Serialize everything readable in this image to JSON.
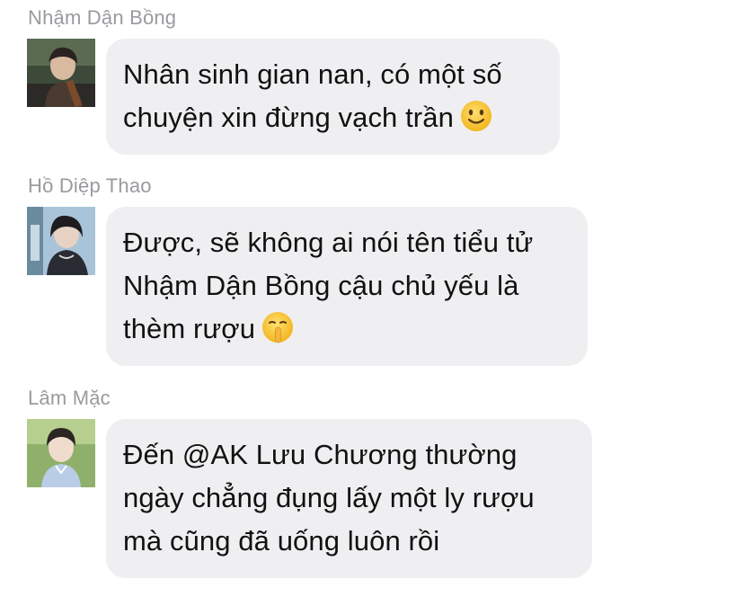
{
  "messages": [
    {
      "sender": "Nhậm Dận Bồng",
      "avatar_icon": "avatar-nham-dan-bong",
      "lines": [
        "Nhân sinh gian nan, có một số",
        "chuyện xin đừng vạch trần"
      ],
      "emoji": "slightly-smiling-face-icon"
    },
    {
      "sender": "Hồ Diệp Thao",
      "avatar_icon": "avatar-ho-diep-thao",
      "lines": [
        "Được, sẽ không ai nói tên tiểu tử",
        "Nhậm Dận Bồng cậu chủ yếu là",
        "thèm rượu"
      ],
      "emoji": "shushing-face-icon"
    },
    {
      "sender": "Lâm Mặc",
      "avatar_icon": "avatar-lam-mac",
      "lines": [
        "Đến @AK Lưu Chương thường",
        "ngày chẳng đụng lấy một ly rượu",
        "mà cũng đã uống luôn rồi"
      ],
      "emoji": ""
    }
  ],
  "colors": {
    "bubble_background": "#efeff1",
    "sender_name": "#9a9a9f",
    "message_text": "#111111",
    "emoji_yellow": "#f7c631"
  }
}
